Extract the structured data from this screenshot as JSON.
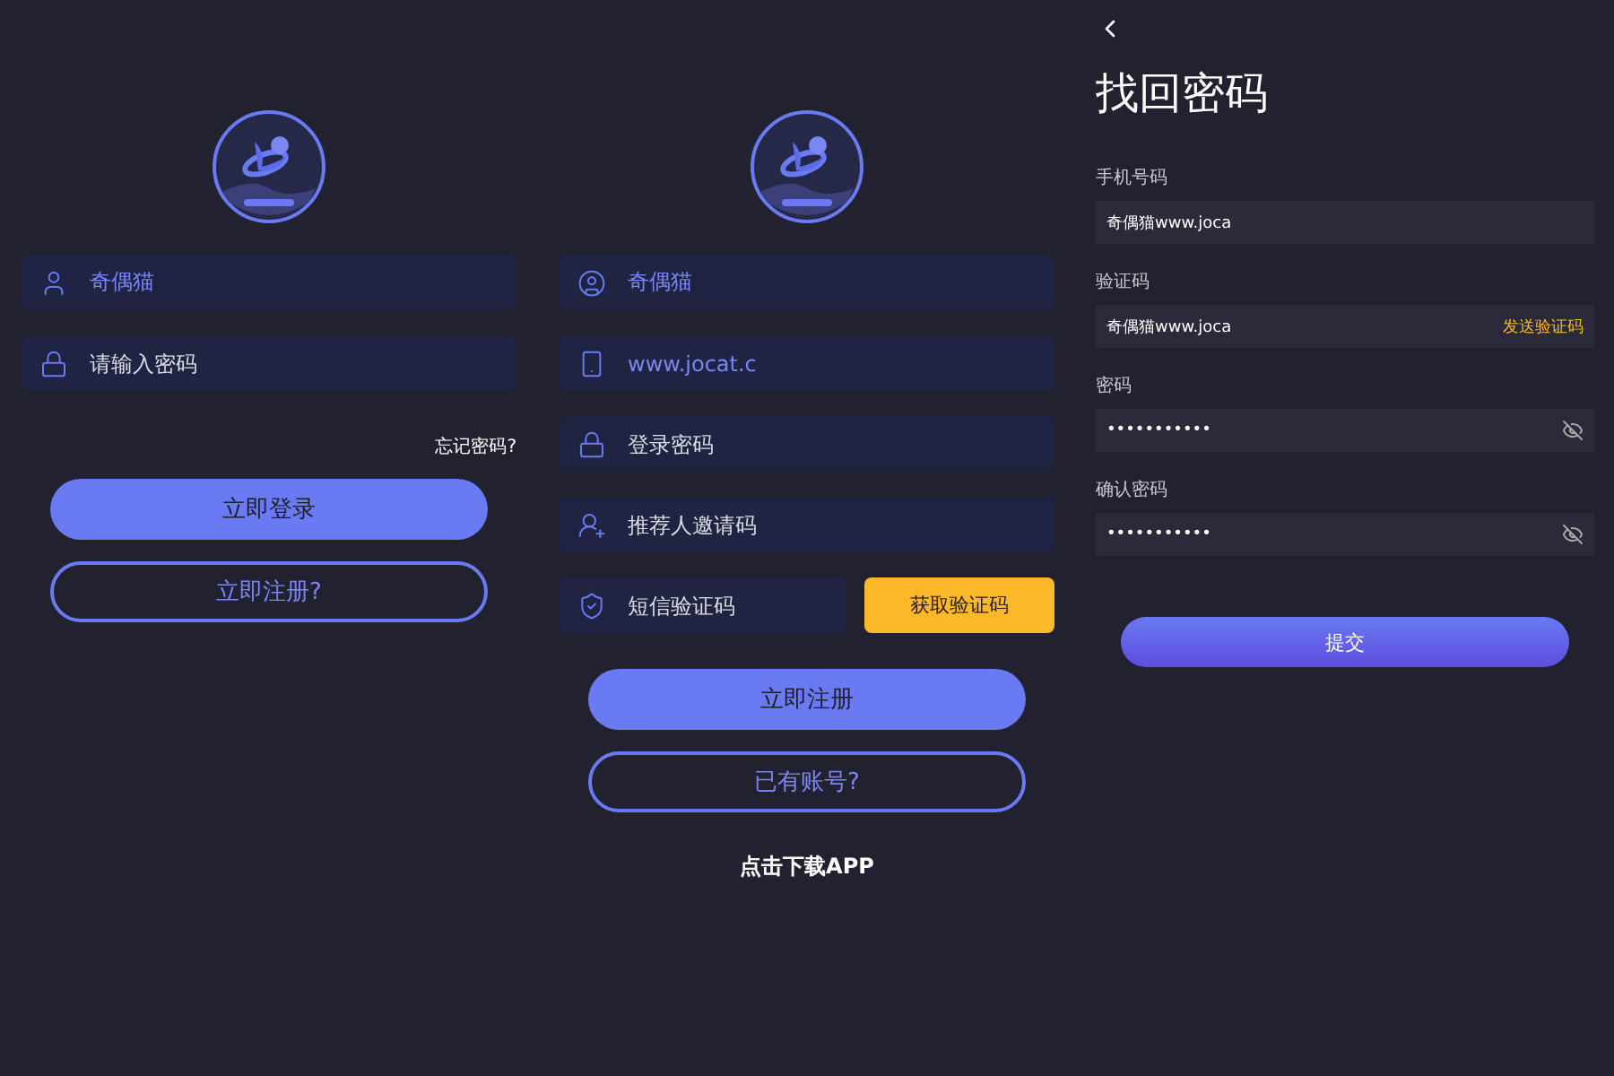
{
  "login": {
    "fields": [
      {
        "kind": "user",
        "value": "奇偶猫"
      },
      {
        "kind": "lock",
        "placeholder": "请输入密码"
      }
    ],
    "forgot_link": "忘记密码?",
    "buttons": [
      {
        "kind": "primary",
        "label": "立即登录"
      },
      {
        "kind": "outline",
        "label": "立即注册?"
      }
    ]
  },
  "register": {
    "fields": [
      {
        "kind": "account",
        "value": "奇偶猫"
      },
      {
        "kind": "phone",
        "value": "www.jocat.c"
      },
      {
        "kind": "lock",
        "placeholder": "登录密码"
      },
      {
        "kind": "invite",
        "placeholder": "推荐人邀请码"
      },
      {
        "kind": "shield",
        "placeholder": "短信验证码"
      }
    ],
    "code_button": "获取验证码",
    "buttons": [
      {
        "kind": "primary",
        "label": "立即注册"
      },
      {
        "kind": "outline",
        "label": "已有账号?"
      }
    ],
    "download_link": "点击下载APP"
  },
  "reset": {
    "title": "找回密码",
    "fields": [
      {
        "kind": "text",
        "label": "手机号码",
        "value": "奇偶猫www.joca"
      },
      {
        "kind": "text",
        "label": "验证码",
        "value": "奇偶猫www.joca",
        "action": "发送验证码"
      },
      {
        "kind": "password",
        "label": "密码",
        "value": "•••••••••••"
      },
      {
        "kind": "password",
        "label": "确认密码",
        "value": "•••••••••••"
      }
    ],
    "submit": "提交"
  }
}
